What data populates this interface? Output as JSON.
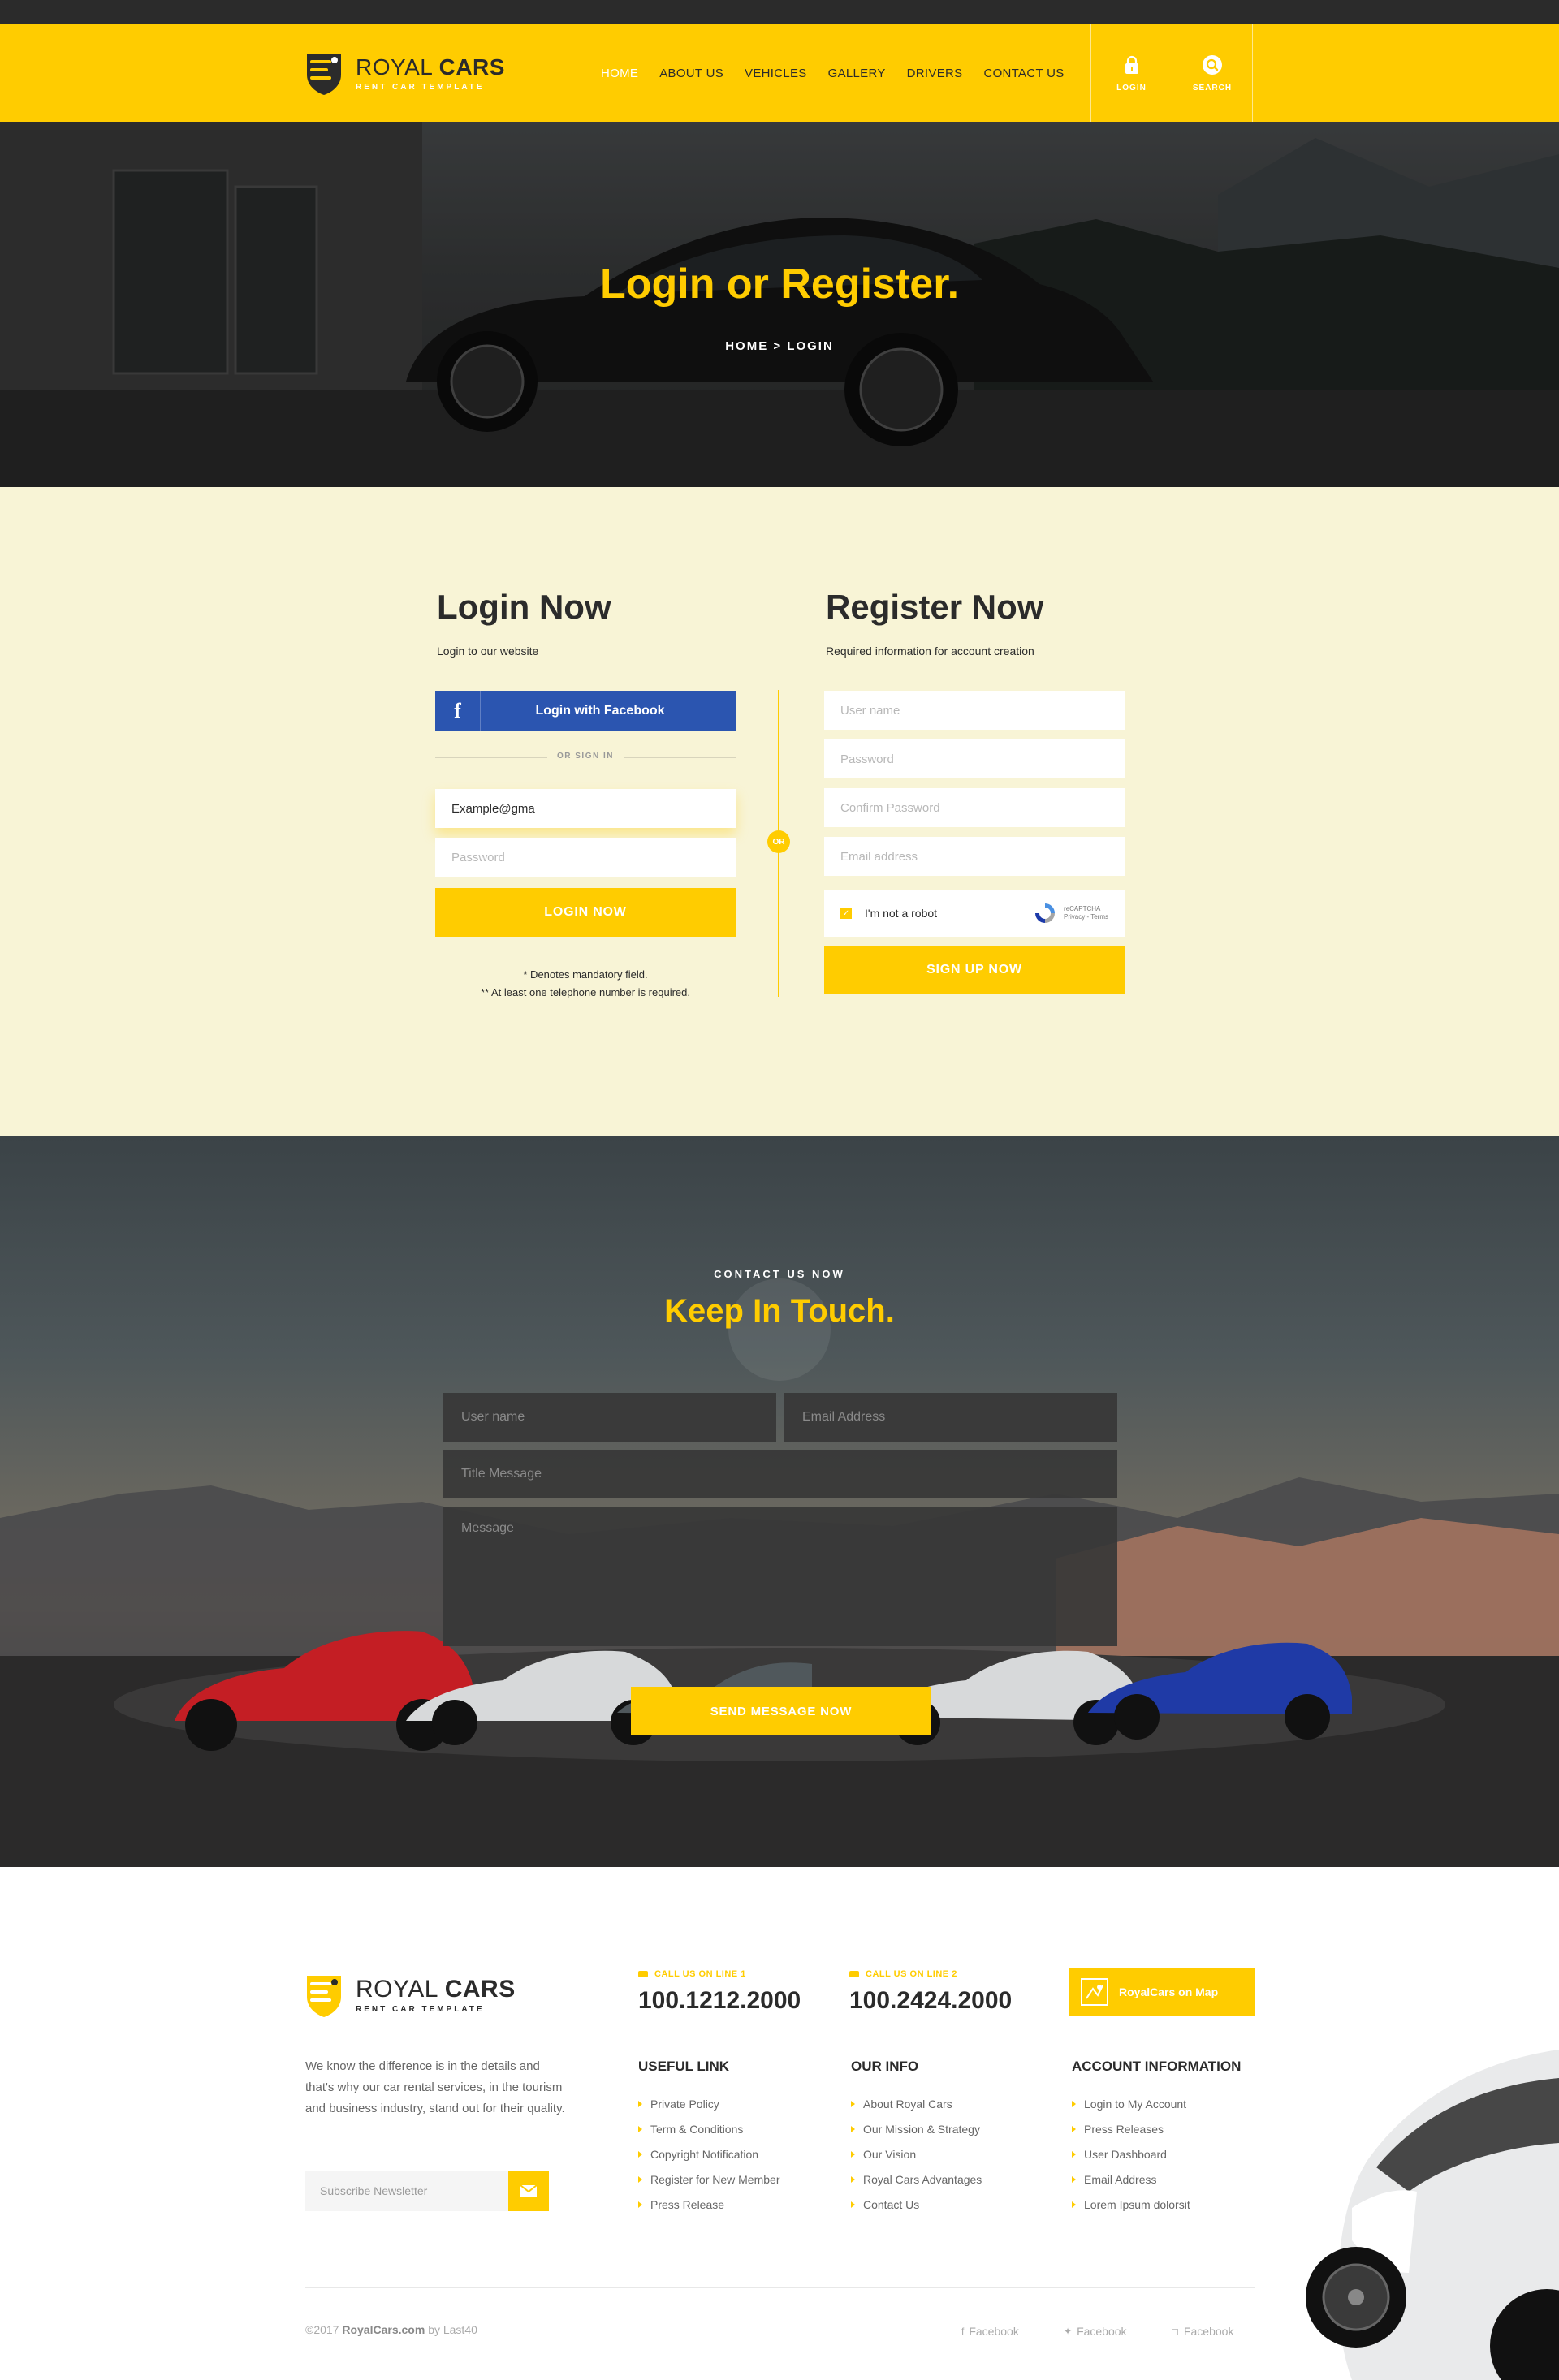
{
  "brand": {
    "name_light": "ROYAL",
    "name_bold": "CARS",
    "tagline": "RENT CAR TEMPLATE"
  },
  "nav": {
    "items": [
      {
        "label": "HOME",
        "active": true
      },
      {
        "label": "ABOUT US",
        "active": false
      },
      {
        "label": "VEHICLES",
        "active": false
      },
      {
        "label": "GALLERY",
        "active": false
      },
      {
        "label": "DRIVERS",
        "active": false
      },
      {
        "label": "CONTACT US",
        "active": false
      }
    ],
    "login_label": "LOGIN",
    "search_label": "SEARCH"
  },
  "hero": {
    "title": "Login or Register.",
    "breadcrumb": "HOME > LOGIN"
  },
  "login": {
    "title_bold": "Login",
    "title_light": "Now",
    "subtitle": "Login to our website",
    "facebook_label": "Login with Facebook",
    "facebook_icon": "facebook-icon",
    "or_sign_in": "OR SIGN IN",
    "email_value": "Example@gma",
    "password_placeholder": "Password",
    "submit_label": "LOGIN NOW",
    "note_1": "* Denotes mandatory field.",
    "note_2": "** At least one telephone number is required."
  },
  "or_badge": "OR",
  "register": {
    "title_bold": "Register",
    "title_light": "Now",
    "subtitle": "Required information for account creation",
    "username_placeholder": "User name",
    "password_placeholder": "Password",
    "confirm_placeholder": "Confirm Password",
    "email_placeholder": "Email address",
    "captcha_label": "I'm not a robot",
    "captcha_brand": "reCAPTCHA",
    "captcha_links": "Privacy - Terms",
    "submit_label": "SIGN UP NOW"
  },
  "contact": {
    "eyebrow": "CONTACT US NOW",
    "title_light": "Keep",
    "title_bold": "In Touch.",
    "username_placeholder": "User name",
    "email_placeholder": "Email Address",
    "title_placeholder": "Title Message",
    "message_placeholder": "Message",
    "submit_label": "SEND MESSAGE NOW"
  },
  "footer": {
    "about": "We know the difference is in the details and that's why our car rental services, in the tourism and business industry, stand out for their quality.",
    "newsletter_placeholder": "Subscribe Newsletter",
    "call_1_label": "CALL US ON LINE 1",
    "call_1_number": "100.1212.2000",
    "call_2_label": "CALL US ON LINE 2",
    "call_2_number": "100.2424.2000",
    "map_label": "RoyalCars on Map",
    "useful_title": "USEFUL LINK",
    "useful_links": [
      "Private Policy",
      "Term & Conditions",
      "Copyright Notification",
      "Register for New Member",
      "Press Release"
    ],
    "info_title": "OUR INFO",
    "info_links": [
      "About Royal Cars",
      "Our Mission & Strategy",
      "Our Vision",
      "Royal Cars Advantages",
      "Contact Us"
    ],
    "account_title": "ACCOUNT INFORMATION",
    "account_links": [
      "Login to My Account",
      "Press Releases",
      "User Dashboard",
      "Email Address",
      "Lorem Ipsum dolorsit"
    ],
    "copyright_year": "©2017",
    "copyright_site": "RoyalCars.com",
    "copyright_by": "by Last40",
    "social_1": "Facebook",
    "social_2": "Facebook",
    "social_3": "Facebook"
  },
  "colors": {
    "accent": "#ffcc00",
    "dark": "#2b2b2b",
    "cream": "#f8f4d6",
    "facebook": "#2b55b0"
  }
}
